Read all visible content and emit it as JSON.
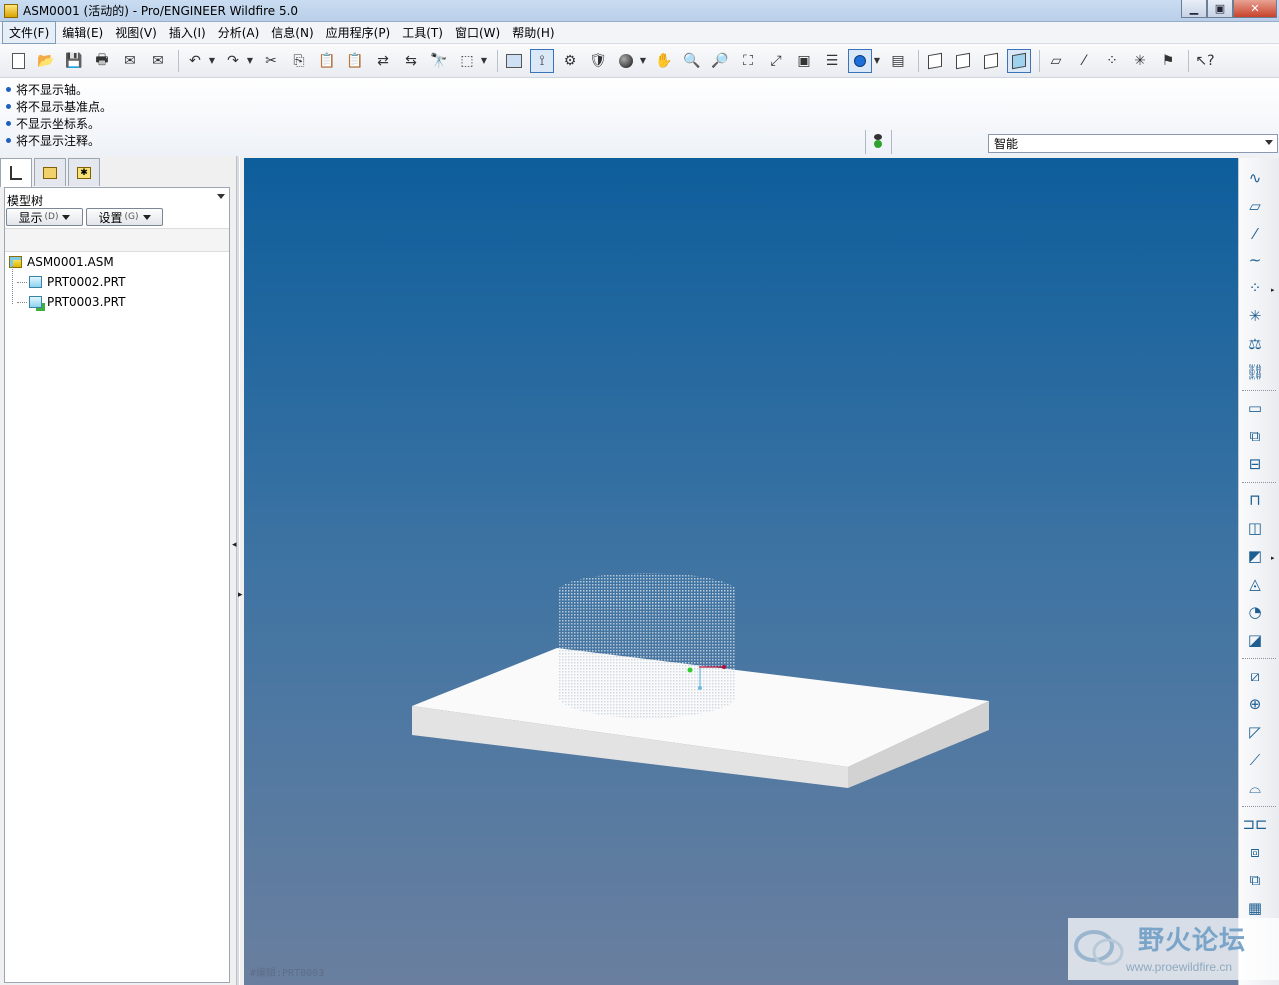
{
  "window": {
    "title": "ASM0001 (活动的) - Pro/ENGINEER Wildfire 5.0",
    "minimize": "▁",
    "maximize": "▣",
    "close": "✕"
  },
  "menubar": {
    "items": [
      "文件(F)",
      "编辑(E)",
      "视图(V)",
      "插入(I)",
      "分析(A)",
      "信息(N)",
      "应用程序(P)",
      "工具(T)",
      "窗口(W)",
      "帮助(H)"
    ]
  },
  "toolbar": {
    "icons": [
      "new-file-icon",
      "open-folder-icon",
      "save-icon",
      "print-icon",
      "send-mail-icon",
      "send-mail-attachment-icon",
      "undo-icon",
      "redo-icon",
      "cut-icon",
      "copy-icon",
      "paste-icon",
      "paste-special-icon",
      "regenerate-icon",
      "regen-manager-icon",
      "find-icon",
      "select-box-icon",
      "repaint-icon",
      "spin-center-icon",
      "orient-mode-icon",
      "saved-views-icon",
      "appearance-sphere-icon",
      "pan-icon",
      "zoom-in-icon",
      "zoom-out-icon",
      "refit-icon",
      "reorient-icon",
      "view-manager-icon",
      "layers-icon",
      "display-style-icon",
      "model-display-icon",
      "wireframe-icon",
      "hidden-line-icon",
      "no-hidden-icon",
      "shading-icon",
      "datum-plane-display-icon",
      "datum-axis-display-icon",
      "point-display-icon",
      "csys-display-icon",
      "annotation-display-icon",
      "context-help-icon"
    ]
  },
  "messages": [
    "将不显示轴。",
    "将不显示基准点。",
    "不显示坐标系。",
    "将不显示注释。"
  ],
  "filter": {
    "selected": "智能"
  },
  "model_tree": {
    "header": "模型树",
    "show_button": "显示",
    "show_shortcut": "(D)",
    "settings_button": "设置",
    "settings_shortcut": "(G)",
    "nodes": [
      {
        "label": "ASM0001.ASM",
        "type": "assembly"
      },
      {
        "label": "PRT0002.PRT",
        "type": "part"
      },
      {
        "label": "PRT0003.PRT",
        "type": "part-new"
      }
    ]
  },
  "graphics": {
    "status": "#编辑:PRT0003"
  },
  "right_toolbar": {
    "icons": [
      "sketch-icon",
      "datum-plane-icon",
      "datum-axis-icon",
      "datum-curve-icon",
      "datum-point-icon",
      "csys-icon",
      "analysis-feature-icon",
      "external-ref-icon",
      "note-icon",
      "component-create-icon",
      "component-operations-icon",
      "extrude-icon",
      "revolve-icon",
      "sweep-icon",
      "blend-icon",
      "hole-icon",
      "round-icon",
      "chamfer-icon",
      "shell-icon",
      "draft-icon",
      "rib-icon",
      "boundary-blend-icon",
      "mirror-icon",
      "merge-icon",
      "intersect-icon",
      "pattern-icon"
    ]
  },
  "watermark": {
    "name": "野火论坛",
    "url": "www.proewildfire.cn"
  },
  "colors": {
    "graphics_top": "#0d5e9c",
    "graphics_bottom": "#6a7f9f",
    "accent": "#3b73b9"
  }
}
